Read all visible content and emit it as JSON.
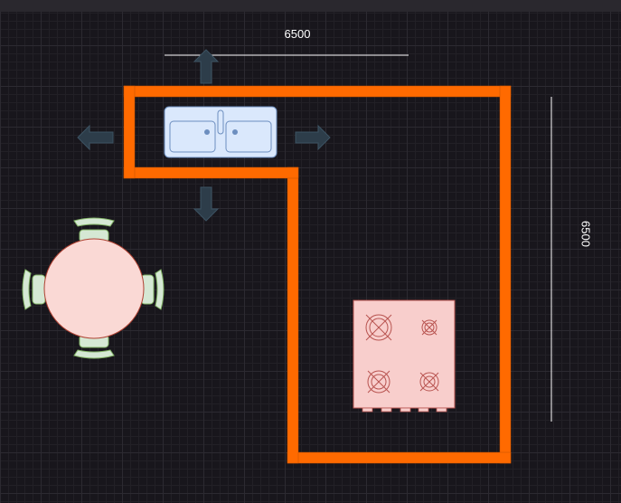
{
  "dimensions": {
    "top_width": "6500",
    "right_height": "6500"
  },
  "colors": {
    "background": "#18161c",
    "wall": "#ff6a00",
    "arrow": "#2d3d4a",
    "sink_fill": "#dae8fc",
    "sink_stroke": "#6c8ebf",
    "table_fill": "#fad9d5",
    "table_stroke": "#ae4132",
    "chair_fill": "#d5e8d4",
    "chair_stroke": "#82b366",
    "stove_fill": "#f8cecc",
    "stove_stroke": "#b85450",
    "dimension_line": "#ffffff"
  },
  "icons": {
    "sink": "double-sink-icon",
    "stove": "cooktop-icon",
    "table": "round-table-icon",
    "chair": "chair-icon",
    "arrow": "resize-arrow-icon"
  }
}
